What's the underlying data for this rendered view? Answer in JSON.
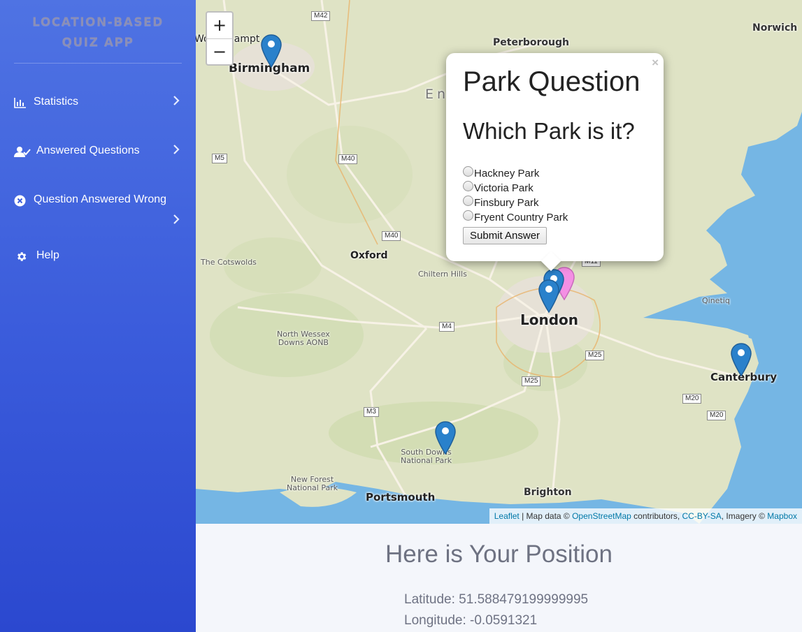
{
  "app": {
    "title_line1": "LOCATION-BASED",
    "title_line2": "QUIZ APP"
  },
  "sidebar": {
    "items": [
      {
        "label": "Statistics",
        "icon": "bar-chart-icon"
      },
      {
        "label": "Answered Questions",
        "icon": "user-check-icon"
      },
      {
        "label": "Question Answered Wrong",
        "icon": "x-circle-icon"
      },
      {
        "label": "Help",
        "icon": "gear-icon"
      }
    ]
  },
  "map": {
    "zoom_in": "+",
    "zoom_out": "−",
    "places": {
      "birmingham": "Birmingham",
      "wolverhampton": "Wolverhampt",
      "peterborough": "Peterborough",
      "norwich": "Norwich",
      "england": "En",
      "oxford": "Oxford",
      "cotswolds": "The Cotswolds",
      "chiltern": "Chiltern Hills",
      "london": "London",
      "qinetiq": "Qinetiq",
      "north_wessex_1": "North Wessex",
      "north_wessex_2": "Downs AONB",
      "canterbury": "Canterbury",
      "south_downs_1": "South Downs",
      "south_downs_2": "National Park",
      "new_forest_1": "New Forest",
      "new_forest_2": "National Park",
      "portsmouth": "Portsmouth",
      "brighton": "Brighton"
    },
    "roads": {
      "m42": "M42",
      "m5": "M5",
      "m40a": "M40",
      "m40b": "M40",
      "m4": "M4",
      "m25a": "M25",
      "m25b": "M25",
      "m3": "M3",
      "m20a": "M20",
      "m20b": "M20",
      "m11": "M11"
    },
    "attribution": {
      "leaflet": "Leaflet",
      "sep1": " | Map data © ",
      "osm": "OpenStreetMap",
      "contributors": " contributors, ",
      "license": "CC-BY-SA",
      "imagery": ", Imagery © ",
      "mapbox": "Mapbox"
    },
    "colors": {
      "land": "#dfe3c5",
      "sea": "#75b6e4",
      "marker_blue": "#2a81cb",
      "marker_pink": "#f48fe4"
    }
  },
  "popup": {
    "close": "×",
    "title": "Park Question",
    "question": "Which Park is it?",
    "options": [
      "Hackney Park",
      "Victoria Park",
      "Finsbury Park",
      "Fryent Country Park"
    ],
    "submit_label": "Submit Answer"
  },
  "position": {
    "heading": "Here is Your Position",
    "latitude": "Latitude: 51.588479199999995",
    "longitude": "Longitude: -0.0591321"
  }
}
